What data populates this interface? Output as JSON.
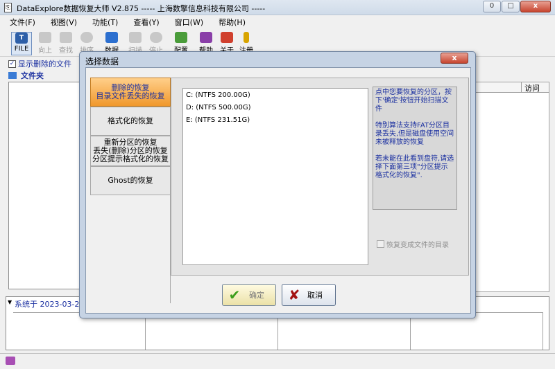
{
  "window": {
    "title": "DataExplore数据恢复大师 V2.875  ----- 上海数擎信息科技有限公司 -----",
    "controls": [
      "0",
      "□",
      "x"
    ]
  },
  "menu": [
    "文件(F)",
    "视图(V)",
    "功能(T)",
    "查看(Y)",
    "窗口(W)",
    "帮助(H)"
  ],
  "toolbar": [
    {
      "label": "FILE",
      "icon": "file-icon",
      "state": "active"
    },
    {
      "label": "向上",
      "icon": "up-icon",
      "state": "disabled"
    },
    {
      "label": "查找",
      "icon": "find-icon",
      "state": "disabled"
    },
    {
      "label": "排序",
      "icon": "sort-icon",
      "state": "disabled"
    },
    {
      "label": "数据",
      "icon": "data-icon",
      "state": "enabled"
    },
    {
      "label": "扫描",
      "icon": "scan-icon",
      "state": "disabled"
    },
    {
      "label": "停止",
      "icon": "stop-icon",
      "state": "disabled"
    },
    {
      "label": "配置",
      "icon": "config-icon",
      "state": "enabled"
    },
    {
      "label": "帮助",
      "icon": "help-icon",
      "state": "enabled"
    },
    {
      "label": "关于",
      "icon": "about-icon",
      "state": "enabled"
    },
    {
      "label": "注册",
      "icon": "register-icon",
      "state": "enabled"
    }
  ],
  "left_panel": {
    "show_deleted_label": "显示删除的文件",
    "show_deleted_checked": true,
    "folder_tab_label": "文件夹"
  },
  "right_panel": {
    "column_access": "访问"
  },
  "log": {
    "text": "系统于  2023-03-2"
  },
  "dialog": {
    "title": "选择数据",
    "close": "x",
    "tabs": [
      {
        "lines": [
          "删除的恢复",
          "目录文件丢失的恢复"
        ],
        "active": true
      },
      {
        "lines": [
          "格式化的恢复"
        ],
        "active": false
      },
      {
        "lines": [
          "重新分区的恢复",
          "丢失(删除)分区的恢复",
          "分区提示格式化的恢复"
        ],
        "active": false
      },
      {
        "lines": [
          "Ghost的恢复"
        ],
        "active": false
      }
    ],
    "disks": [
      "C:  (NTFS 200.00G)",
      "D:  (NTFS 500.00G)",
      "E:  (NTFS 231.51G)"
    ],
    "help": [
      "点中您要恢复的分区，按下'确定'按钮开始扫描文件",
      "特别算法支持FAT分区目录丢失,但是磁盘使用空间未被释放的恢复",
      "若未能在此看到盘符,请选择下面第三项\"分区提示格式化的恢复\"."
    ],
    "recover_dir_label": "恢复变成文件的目录",
    "recover_dir_checked": false,
    "ok_label": "确定",
    "cancel_label": "取消",
    "colors": {
      "active_tab": "#f0982c",
      "help_text": "#1a2fa0"
    }
  }
}
